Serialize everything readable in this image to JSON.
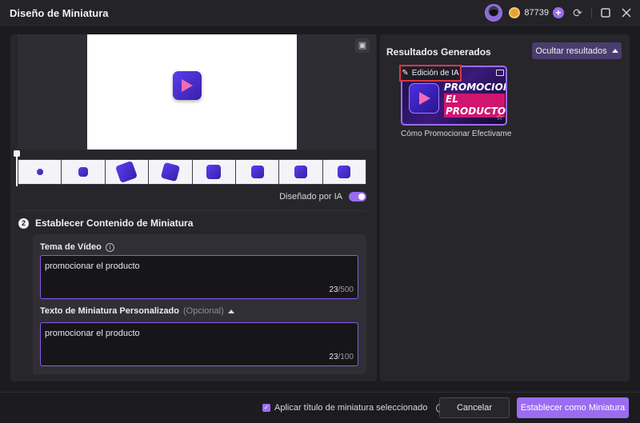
{
  "window": {
    "title": "Diseño de Miniatura",
    "credits": "87739",
    "controls": [
      "refresh-icon",
      "maximize-icon",
      "close-icon"
    ]
  },
  "preview": {
    "frames_count": 8
  },
  "ai_toggle": {
    "label": "Diseñado por IA",
    "on": true
  },
  "section": {
    "step": "2",
    "title": "Establecer Contenido de Miniatura"
  },
  "video_topic": {
    "label": "Tema de Vídeo",
    "value": "promocionar el producto",
    "count": "23",
    "max": "/500"
  },
  "custom_text": {
    "label": "Texto de Miniatura Personalizado",
    "optional": "(Opcional)",
    "value": "promocionar el producto",
    "count": "23",
    "max": "/100"
  },
  "results": {
    "title": "Resultados Generados",
    "hide_button": "Ocultar resultados",
    "items": [
      {
        "tag": "Edición de IA",
        "headline_1": "PROMOCIONAR",
        "headline_2": "EL PRODUCTO",
        "caption": "Cómo Promocionar Efectivame..."
      }
    ]
  },
  "footer": {
    "apply_title_label": "Aplicar título de miniatura seleccionado",
    "apply_title_checked": true,
    "cancel": "Cancelar",
    "confirm": "Establecer como Miniatura"
  },
  "colors": {
    "accent": "#9b6cf2",
    "highlight_border": "#e0343f",
    "background": "#1c1c20"
  }
}
